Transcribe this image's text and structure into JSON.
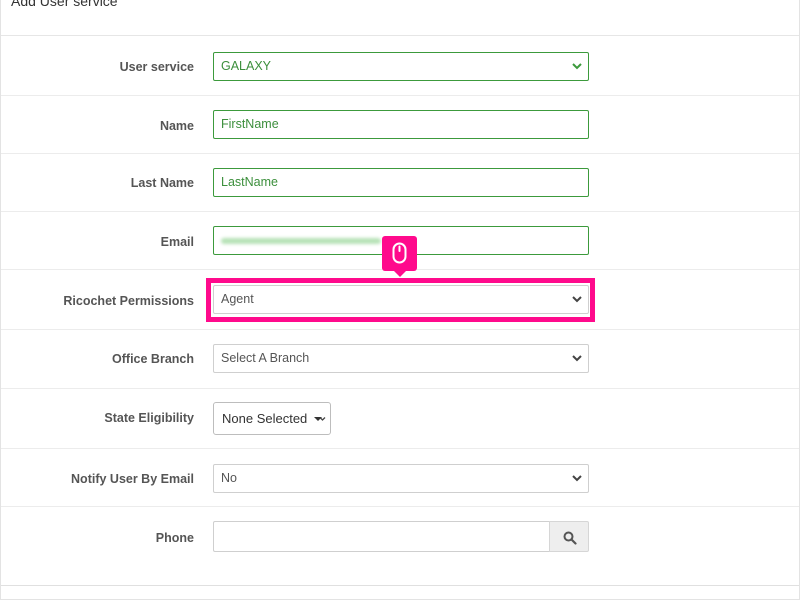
{
  "panel": {
    "title": "Add User service"
  },
  "form": {
    "user_service": {
      "label": "User service",
      "value": "GALAXY"
    },
    "name": {
      "label": "Name",
      "value": "FirstName"
    },
    "last_name": {
      "label": "Last Name",
      "value": "LastName"
    },
    "email": {
      "label": "Email",
      "value": ""
    },
    "ricochet_permissions": {
      "label": "Ricochet Permissions",
      "value": "Agent"
    },
    "office_branch": {
      "label": "Office Branch",
      "value": "Select A Branch"
    },
    "state_eligibility": {
      "label": "State Eligibility",
      "value": "None Selected"
    },
    "notify_user_by_email": {
      "label": "Notify User By Email",
      "value": "No"
    },
    "phone": {
      "label": "Phone",
      "value": ""
    }
  },
  "colors": {
    "highlight": "#ff0a8c",
    "valid": "#3c9a3c",
    "label": "#555555"
  },
  "icons": {
    "cursor": "mouse-icon",
    "phone_button": "search-icon",
    "dropdown": "chevron-down-icon"
  }
}
